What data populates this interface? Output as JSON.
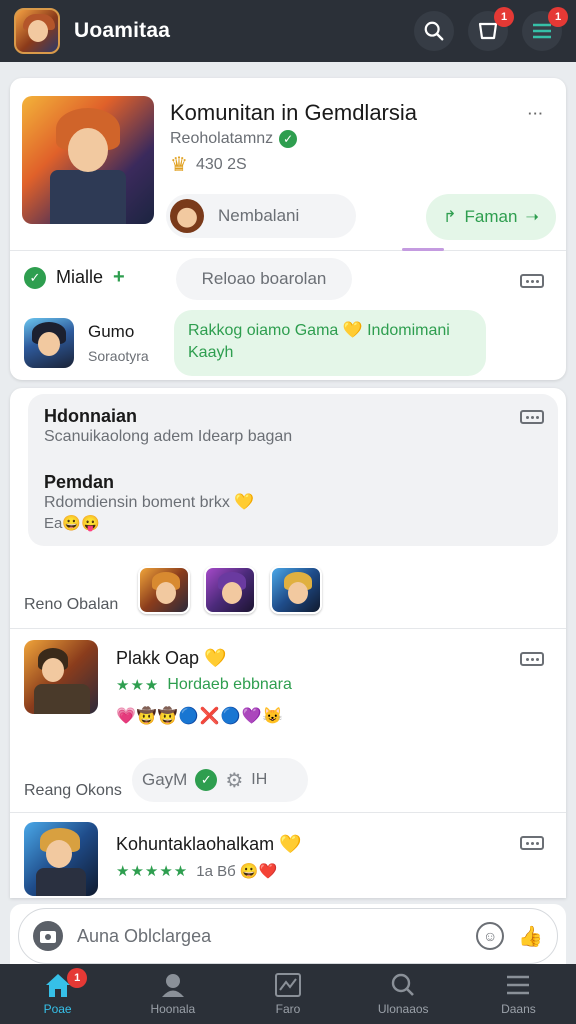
{
  "header": {
    "title": "Uoamitaa",
    "search_icon": "search-icon",
    "cart_badge": "1",
    "menu_badge": "1"
  },
  "community": {
    "title": "Komunitan in Gemdlarsia",
    "subtitle": "Reoholatamnz",
    "stats": "430 2S",
    "member_name": "Nembalani",
    "join_label": "Faman",
    "filter_label": "Mialle",
    "filter_plus": "+",
    "search_pill": "Reloao boarolan",
    "game_name": "Gumo",
    "game_sub": "Soraotyra",
    "message": "Rakkog oiamo Gama 💛 Indomimani Kaayh"
  },
  "post1": {
    "heading1": "Hdonnaian",
    "text1": "Scanuikaolong adem Idearp bagan",
    "heading2": "Pemdan",
    "text2": "Rdomdiensin boment brkx 💛",
    "text3": "Ea😀😛",
    "related_label": "Reno Obalan"
  },
  "post2": {
    "title": "Plakk Oap 💛",
    "stars": "★★★",
    "subtitle": "Hordaeb ebbnara",
    "emojis": "💗🤠🤠🔵❌🔵💜😺",
    "reactions_label": "Reang Okons",
    "reaction_pill": "GayM",
    "reaction_count": "IH"
  },
  "post3": {
    "title": "Kohuntaklaohalkam 💛",
    "stars": "★★★★★",
    "meta": "1а Вб 😀❤️"
  },
  "composer": {
    "placeholder": "Auna Oblclargea"
  },
  "nav": {
    "items": [
      {
        "label": "Poae",
        "badge": "1"
      },
      {
        "label": "Hoonala"
      },
      {
        "label": "Faro"
      },
      {
        "label": "Ulonaaos"
      },
      {
        "label": "Daans"
      }
    ]
  },
  "colors": {
    "topbar": "#2b3038",
    "accent_green": "#2e9e4f",
    "accent_cyan": "#36c0e8",
    "badge_red": "#e53935",
    "pill_green": "#e4f6e8"
  }
}
